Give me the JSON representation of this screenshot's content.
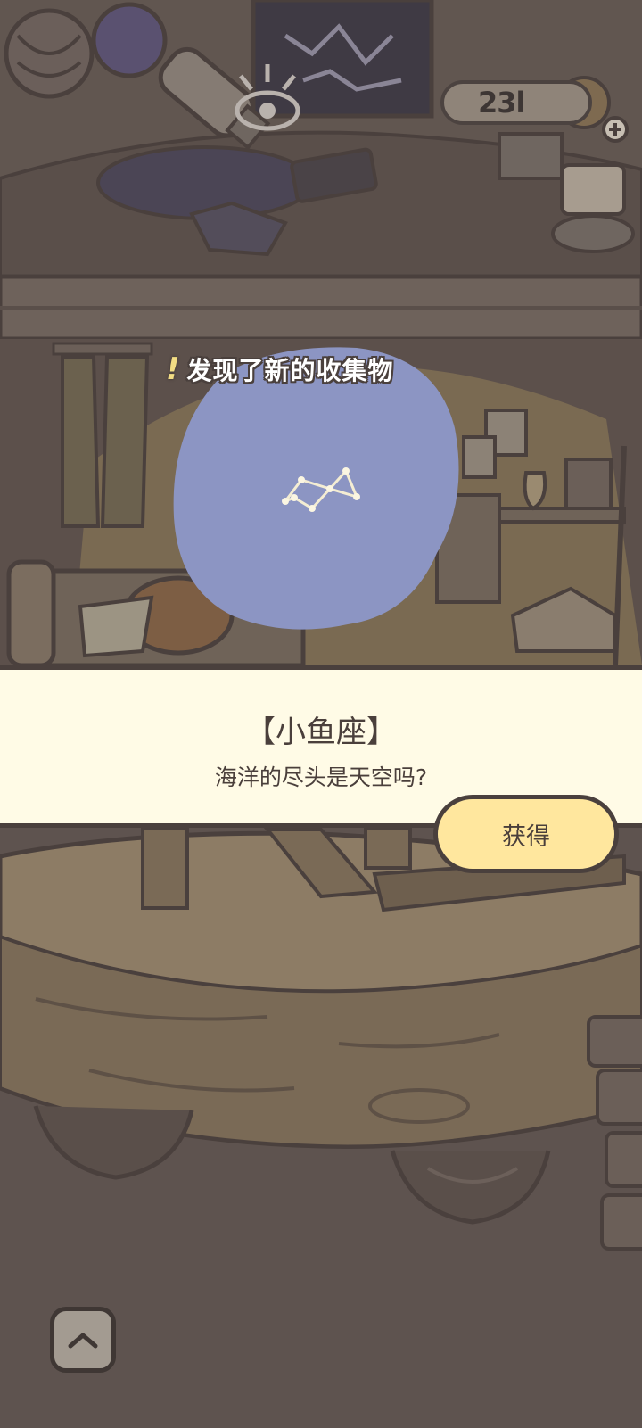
{
  "hud": {
    "counter": "23l"
  },
  "discovery": {
    "banner": "发现了新的收集物",
    "icon": "exclamation-icon"
  },
  "item": {
    "name": "【小鱼座】",
    "description": "海洋的尽头是天空吗?",
    "constellation": "constellation-icon"
  },
  "actions": {
    "get_label": "获得",
    "scroll_up_icon": "chevron-up-icon"
  },
  "colors": {
    "panel": "#fffbe6",
    "button": "#ffe79e",
    "bubble": "#8c95c3",
    "outline": "#4a403d"
  }
}
